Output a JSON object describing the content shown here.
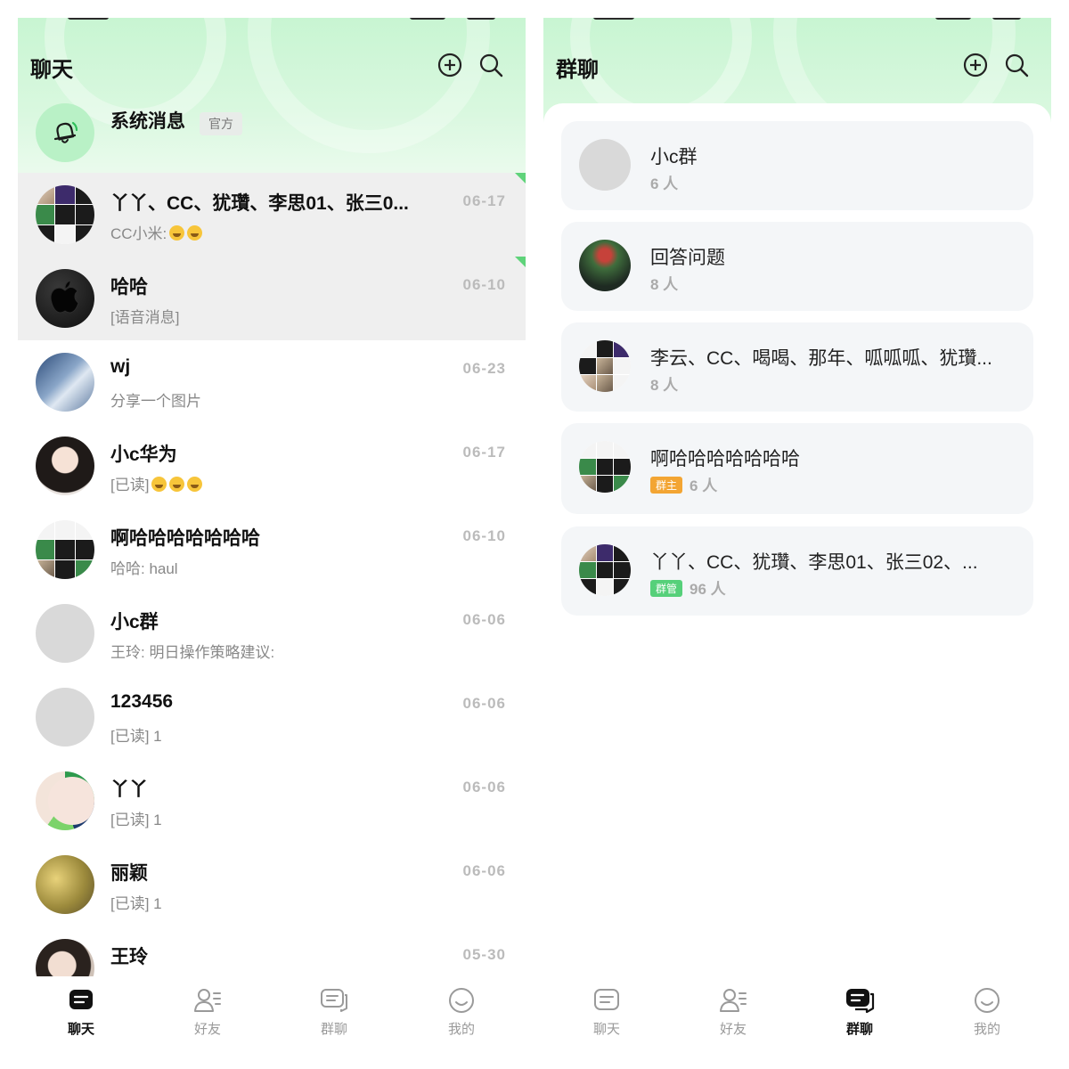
{
  "chats_screen": {
    "title": "聊天",
    "system": {
      "name": "系统消息",
      "badge": "官方"
    },
    "items": [
      {
        "name": "丫丫、CC、犹瓚、李思01、张三0...",
        "preview": "CC小米:",
        "emoji_count": 2,
        "time": "06-17",
        "pinned": true,
        "avatar": "group-mosaic"
      },
      {
        "name": "哈哈",
        "preview": "[语音消息]",
        "time": "06-10",
        "pinned": true,
        "avatar": "apple-logo"
      },
      {
        "name": "wj",
        "preview": "分享一个图片",
        "time": "06-23",
        "pinned": false,
        "avatar": "photo-car"
      },
      {
        "name": "小c华为",
        "preview": "[已读]",
        "emoji_count": 3,
        "time": "06-17",
        "pinned": false,
        "avatar": "photo-girl"
      },
      {
        "name": "啊哈哈哈哈哈哈哈",
        "preview": "哈哈: haul",
        "time": "06-10",
        "pinned": false,
        "avatar": "group-mosaic"
      },
      {
        "name": "小c群",
        "preview": "王玲: 明日操作策略建议:",
        "time": "06-06",
        "pinned": false,
        "avatar": "placeholder"
      },
      {
        "name": "123456",
        "preview": "[已读] 1",
        "time": "06-06",
        "pinned": false,
        "avatar": "placeholder"
      },
      {
        "name": "丫丫",
        "preview": "[已读] 1",
        "time": "06-06",
        "pinned": false,
        "avatar": "circle-colorful"
      },
      {
        "name": "丽颖",
        "preview": "[已读] 1",
        "time": "06-06",
        "pinned": false,
        "avatar": "photo-fruit"
      },
      {
        "name": "王玲",
        "preview": "",
        "time": "05-30",
        "pinned": false,
        "avatar": "photo-woman"
      }
    ]
  },
  "groups_screen": {
    "title": "群聊",
    "items": [
      {
        "name": "小c群",
        "badge": "",
        "count": "6 人",
        "avatar": "placeholder"
      },
      {
        "name": "回答问题",
        "badge": "",
        "count": "8 人",
        "avatar": "photo-tower"
      },
      {
        "name": "李云、CC、喝喝、那年、呱呱呱、犹瓚...",
        "badge": "",
        "count": "8 人",
        "avatar": "group-mosaic"
      },
      {
        "name": "啊哈哈哈哈哈哈哈",
        "badge": "群主",
        "badge_type": "owner",
        "count": "6 人",
        "avatar": "group-mosaic"
      },
      {
        "name": "丫丫、CC、犹瓚、李思01、张三02、...",
        "badge": "群管",
        "badge_type": "admin",
        "count": "96 人",
        "avatar": "group-mosaic"
      }
    ]
  },
  "tabs": [
    "聊天",
    "好友",
    "群聊",
    "我的"
  ],
  "tab_icons": [
    "chat-bubble-icon",
    "friends-icon",
    "group-chat-icon",
    "profile-smile-icon"
  ],
  "header_icons": [
    "add-circle-icon",
    "search-icon"
  ],
  "colors": {
    "accent_green": "#5fd37a",
    "header_tint": "#c8f5d2",
    "owner_badge": "#f3a533",
    "admin_badge": "#56d07a"
  }
}
